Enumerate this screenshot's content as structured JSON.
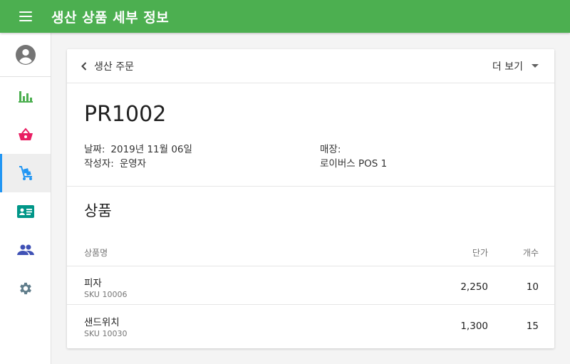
{
  "appbar": {
    "title": "생산 상품 세부 정보",
    "color": "#4caf50",
    "menu_icon": "hamburger-menu-icon"
  },
  "sidebar": {
    "avatar_icon": "account-circle-icon",
    "items": [
      {
        "icon": "bar-chart-icon",
        "color": "#4caf50",
        "active": false
      },
      {
        "icon": "shopping-basket-icon",
        "color": "#e91e63",
        "active": false
      },
      {
        "icon": "hand-truck-icon",
        "color": "#2196f3",
        "active": true
      },
      {
        "icon": "id-card-icon",
        "color": "#009688",
        "active": false
      },
      {
        "icon": "people-icon",
        "color": "#3f51b5",
        "active": false
      },
      {
        "icon": "settings-gear-icon",
        "color": "#607d8b",
        "active": false
      }
    ]
  },
  "card": {
    "back_label": "생산 주문",
    "more_label": "더 보기",
    "order_id": "PR1002",
    "date_label": "날짜:",
    "date_value": "2019년 11월 06일",
    "author_label": "작성자:",
    "author_value": "운영자",
    "store_label": "매장:",
    "store_value": "로이버스 POS 1"
  },
  "products": {
    "title": "상품",
    "columns": {
      "name": "상품명",
      "price": "단가",
      "qty": "개수"
    },
    "rows": [
      {
        "name": "피자",
        "sku": "SKU 10006",
        "price": "2,250",
        "qty": "10"
      },
      {
        "name": "샌드위치",
        "sku": "SKU 10030",
        "price": "1,300",
        "qty": "15"
      }
    ]
  }
}
